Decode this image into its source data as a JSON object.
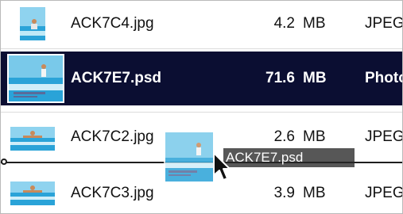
{
  "files": [
    {
      "name": "ACK7C4.jpg",
      "size": "4.2",
      "unit": "MB",
      "kind": "JPEG",
      "selected": false,
      "thumb": "beach-thumbnail"
    },
    {
      "name": "ACK7E7.psd",
      "size": "71.6",
      "unit": "MB",
      "kind": "Photo",
      "selected": true,
      "thumb": "beach-thumbnail"
    },
    {
      "name": "ACK7C2.jpg",
      "size": "2.6",
      "unit": "MB",
      "kind": "JPEG",
      "selected": false,
      "thumb": "beach-thumbnail"
    },
    {
      "name": "ACK7C3.jpg",
      "size": "3.9",
      "unit": "MB",
      "kind": "JPEG",
      "selected": false,
      "thumb": "beach-thumbnail"
    }
  ],
  "drag": {
    "label": "ACK7E7.psd",
    "icon": "pointer-cursor-icon"
  },
  "colors": {
    "selection": "#0b0e32",
    "sky": "#79c9ea",
    "sea": "#2aa3d8"
  }
}
